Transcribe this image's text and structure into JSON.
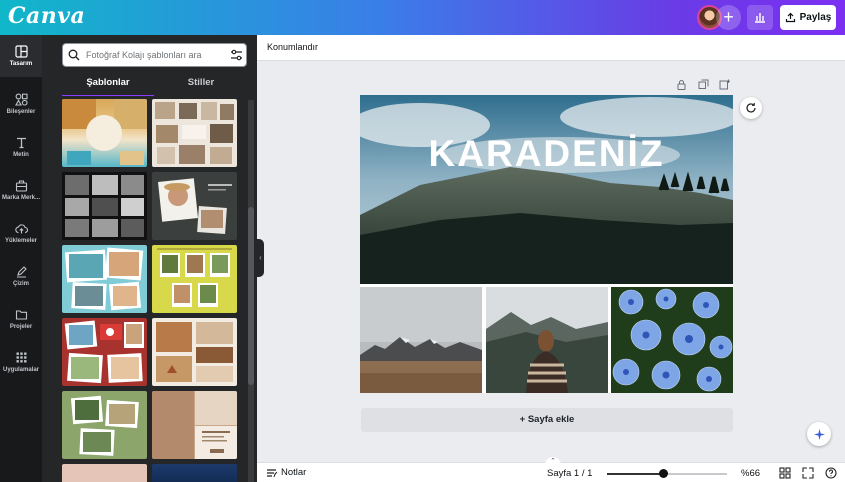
{
  "app": {
    "logo": "Canva",
    "share_label": "Paylaş",
    "colors": {
      "accent": "#8b3dff",
      "rail_bg": "#18191b",
      "panel_bg": "#252627"
    }
  },
  "rail": {
    "items": [
      {
        "label": "Tasarım",
        "icon": "layout-icon",
        "active": true
      },
      {
        "label": "Bileşenler",
        "icon": "elements-icon",
        "active": false
      },
      {
        "label": "Metin",
        "icon": "text-icon",
        "active": false
      },
      {
        "label": "Marka Merk...",
        "icon": "brand-kit-icon",
        "active": false
      },
      {
        "label": "Yüklemeler",
        "icon": "upload-cloud-icon",
        "active": false
      },
      {
        "label": "Çizim",
        "icon": "pen-icon",
        "active": false
      },
      {
        "label": "Projeler",
        "icon": "folder-icon",
        "active": false
      },
      {
        "label": "Uygulamalar",
        "icon": "apps-grid-icon",
        "active": false
      }
    ]
  },
  "panel": {
    "search_placeholder": "Fotoğraf Kolajı şablonları ara",
    "tabs": [
      {
        "label": "Şablonlar",
        "active": true
      },
      {
        "label": "Stiller",
        "active": false
      }
    ]
  },
  "context_bar": {
    "position_label": "Konumlandır"
  },
  "design": {
    "hero_title": "KARADENİZ"
  },
  "canvas": {
    "add_page_label": "+ Sayfa ekle"
  },
  "bottom_bar": {
    "notes_label": "Notlar",
    "page_indicator": "Sayfa 1 / 1",
    "zoom_label": "%66",
    "zoom_fraction": 0.47
  }
}
